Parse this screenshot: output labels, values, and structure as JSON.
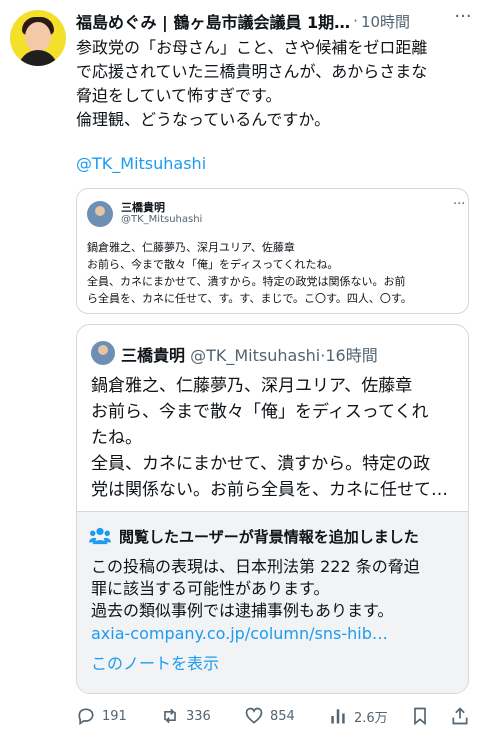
{
  "author": {
    "name": "福島めぐみ | 鶴ヶ島市議会議員 1期…",
    "separator": "·",
    "time": "10時間",
    "more": "···"
  },
  "tweet": {
    "text": "参政党の「お母さん」こと、さや候補をゼロ距離\nで応援されていた三橋貴明さんが、あからさまな\n脅迫をしていて怖すぎです。\n倫理観、どうなっているんですか。",
    "mention": "@TK_Mitsuhashi"
  },
  "embed1": {
    "name": "三橋貴明",
    "handle": "@TK_Mitsuhashi",
    "more": "···",
    "text": "鍋倉雅之、仁藤夢乃、深月ユリア、佐藤章\nお前ら、今まで散々「俺」をディスってくれたね。\n全員、カネにまかせて、潰すから。特定の政党は関係ない。お前\nら全員を、カネに任せて、す。す、まじで。こ〇す。四人、〇す。"
  },
  "embed2": {
    "name": "三橋貴明",
    "handle": "@TK_Mitsuhashi",
    "separator": "·",
    "time": "16時間",
    "text": "鍋倉雅之、仁藤夢乃、深月ユリア、佐藤章\nお前ら、今まで散々「俺」をディスってくれ\nたね。\n全員、カネにまかせて、潰すから。特定の政\n党は関係ない。お前ら全員を、カネに任せて…"
  },
  "note": {
    "icon": "users-icon",
    "title": "閲覧したユーザーが背景情報を追加しました",
    "body": "この投稿の表現は、日本刑法第 222 条の脅迫\n罪に該当する可能性があります。\n過去の類似事例では逮捕事例もあります。",
    "link": "axia-company.co.jp/column/sns-hib…",
    "show": "このノートを表示"
  },
  "actions": {
    "reply_count": "191",
    "repost_count": "336",
    "like_count": "854",
    "view_count": "2.6万"
  },
  "colors": {
    "accent": "#1d9bf0",
    "secondary_text": "#536471",
    "border": "#cfd9de",
    "note_bg": "#f1f3f5"
  }
}
